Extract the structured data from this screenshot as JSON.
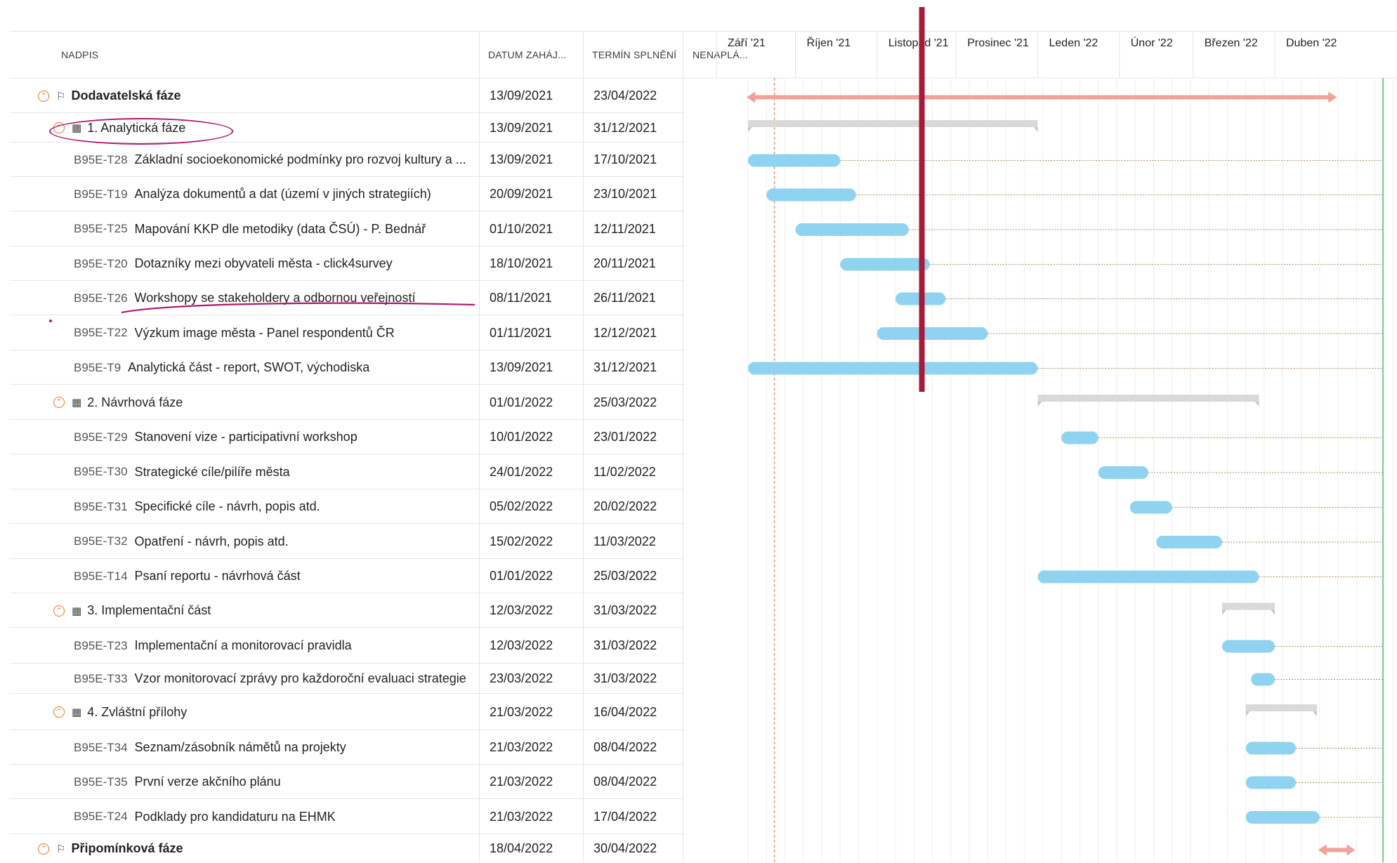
{
  "columns": {
    "name": "NADPIS",
    "start": "DATUM ZAHÁJ...",
    "end": "TERMÍN SPLNĚNÍ",
    "unplanned": "NENAPLÁ..."
  },
  "timeline": {
    "months": [
      "Září '21",
      "Říjen '21",
      "Listopad '21",
      "Prosinec '21",
      "Leden '22",
      "Únor '22",
      "Březen '22",
      "Duben '22"
    ],
    "start_date": "2021-09-01",
    "today_marker": "2021-09-23",
    "current_marker": "2021-11-18"
  },
  "rows": [
    {
      "kind": "phase",
      "level": 0,
      "code": "",
      "name": "Dodavatelská fáze",
      "start": "13/09/2021",
      "end": "23/04/2022",
      "bar": "red",
      "icon": "milestone-icon"
    },
    {
      "kind": "group",
      "level": 1,
      "code": "",
      "name": "1. Analytická fáze",
      "start": "13/09/2021",
      "end": "31/12/2021",
      "bar": "summary",
      "icon": "calendar-icon"
    },
    {
      "kind": "task",
      "level": 2,
      "code": "B95E-T28",
      "name": "Základní socioekonomické podmínky pro rozvoj kultury a ...",
      "start": "13/09/2021",
      "end": "17/10/2021",
      "bar": "task"
    },
    {
      "kind": "task",
      "level": 2,
      "code": "B95E-T19",
      "name": "Analýza dokumentů a dat (území v jiných strategiích)",
      "start": "20/09/2021",
      "end": "23/10/2021",
      "bar": "task"
    },
    {
      "kind": "task",
      "level": 2,
      "code": "B95E-T25",
      "name": "Mapování KKP dle metodiky (data ČSÚ) - P. Bednář",
      "start": "01/10/2021",
      "end": "12/11/2021",
      "bar": "task"
    },
    {
      "kind": "task",
      "level": 2,
      "code": "B95E-T20",
      "name": "Dotazníky mezi obyvateli města - click4survey",
      "start": "18/10/2021",
      "end": "20/11/2021",
      "bar": "task"
    },
    {
      "kind": "task",
      "level": 2,
      "code": "B95E-T26",
      "name": "Workshopy se stakeholdery a odbornou veřejností",
      "start": "08/11/2021",
      "end": "26/11/2021",
      "bar": "task"
    },
    {
      "kind": "task",
      "level": 2,
      "code": "B95E-T22",
      "name": "Výzkum image města - Panel respondentů ČR",
      "start": "01/11/2021",
      "end": "12/12/2021",
      "bar": "task"
    },
    {
      "kind": "task",
      "level": 2,
      "code": "B95E-T9",
      "name": "Analytická část - report, SWOT, východiska",
      "start": "13/09/2021",
      "end": "31/12/2021",
      "bar": "task"
    },
    {
      "kind": "group",
      "level": 1,
      "code": "",
      "name": "2. Návrhová fáze",
      "start": "01/01/2022",
      "end": "25/03/2022",
      "bar": "summary",
      "icon": "calendar-icon"
    },
    {
      "kind": "task",
      "level": 2,
      "code": "B95E-T29",
      "name": "Stanovení vize - participativní workshop",
      "start": "10/01/2022",
      "end": "23/01/2022",
      "bar": "task"
    },
    {
      "kind": "task",
      "level": 2,
      "code": "B95E-T30",
      "name": "Strategické cíle/pilíře města",
      "start": "24/01/2022",
      "end": "11/02/2022",
      "bar": "task"
    },
    {
      "kind": "task",
      "level": 2,
      "code": "B95E-T31",
      "name": "Specifické cíle - návrh, popis atd.",
      "start": "05/02/2022",
      "end": "20/02/2022",
      "bar": "task"
    },
    {
      "kind": "task",
      "level": 2,
      "code": "B95E-T32",
      "name": "Opatření - návrh, popis atd.",
      "start": "15/02/2022",
      "end": "11/03/2022",
      "bar": "task"
    },
    {
      "kind": "task",
      "level": 2,
      "code": "B95E-T14",
      "name": "Psaní reportu - návrhová část",
      "start": "01/01/2022",
      "end": "25/03/2022",
      "bar": "task"
    },
    {
      "kind": "group",
      "level": 1,
      "code": "",
      "name": "3. Implementační část",
      "start": "12/03/2022",
      "end": "31/03/2022",
      "bar": "summary",
      "icon": "calendar-icon"
    },
    {
      "kind": "task",
      "level": 2,
      "code": "B95E-T23",
      "name": "Implementační a monitorovací pravidla",
      "start": "12/03/2022",
      "end": "31/03/2022",
      "bar": "task"
    },
    {
      "kind": "task",
      "level": 2,
      "code": "B95E-T33",
      "name": "Vzor monitorovací zprávy pro každoroční evaluaci strategie",
      "start": "23/03/2022",
      "end": "31/03/2022",
      "bar": "task"
    },
    {
      "kind": "group",
      "level": 1,
      "code": "",
      "name": "4. Zvláštní přílohy",
      "start": "21/03/2022",
      "end": "16/04/2022",
      "bar": "summary",
      "icon": "calendar-icon"
    },
    {
      "kind": "task",
      "level": 2,
      "code": "B95E-T34",
      "name": "Seznam/zásobník námětů na projekty",
      "start": "21/03/2022",
      "end": "08/04/2022",
      "bar": "task"
    },
    {
      "kind": "task",
      "level": 2,
      "code": "B95E-T35",
      "name": "První verze akčního plánu",
      "start": "21/03/2022",
      "end": "08/04/2022",
      "bar": "task"
    },
    {
      "kind": "task",
      "level": 2,
      "code": "B95E-T24",
      "name": "Podklady pro kandidaturu na EHMK",
      "start": "21/03/2022",
      "end": "17/04/2022",
      "bar": "task"
    },
    {
      "kind": "phase",
      "level": 0,
      "code": "",
      "name": "Připomínková fáze",
      "start": "18/04/2022",
      "end": "30/04/2022",
      "bar": "red",
      "icon": "milestone-icon"
    }
  ],
  "colors": {
    "task_bar": "#8fd3f0",
    "summary_bar": "#d9d9d9",
    "phase_bar": "#f2a19a",
    "toggle": "#e3782f",
    "current_marker": "#a51c3a",
    "today_line": "#f08060",
    "end_line": "#6fd08c",
    "annotation": "#b0176d",
    "dotted": "#b08a5a"
  }
}
